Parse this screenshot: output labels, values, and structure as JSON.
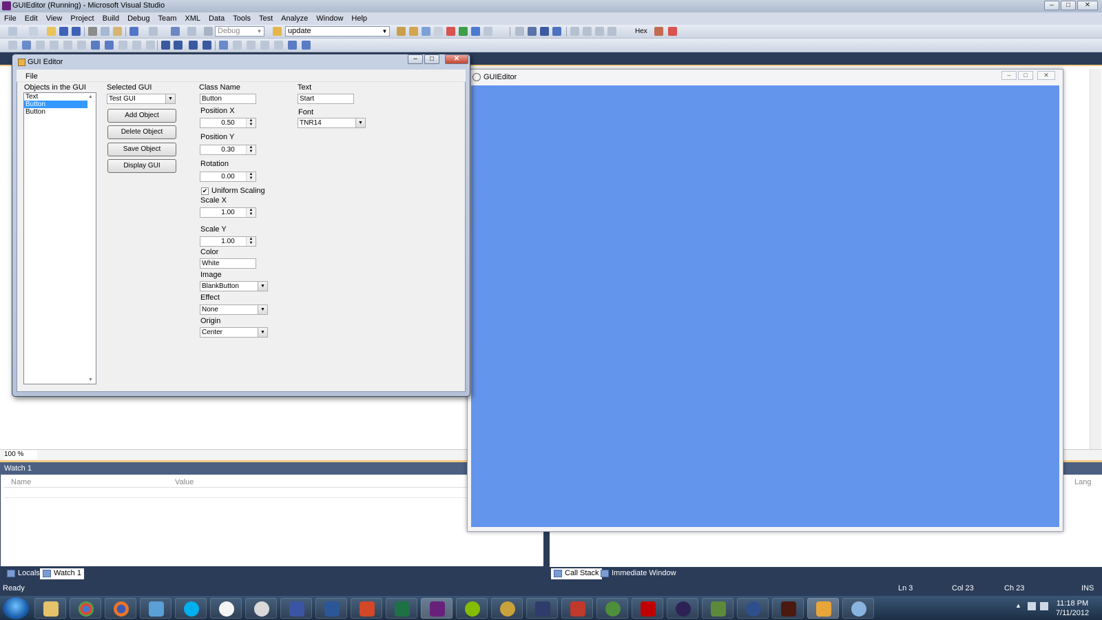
{
  "vs": {
    "title": "GUIEditor (Running) - Microsoft Visual Studio",
    "menu": [
      "File",
      "Edit",
      "View",
      "Project",
      "Build",
      "Debug",
      "Team",
      "XML",
      "Data",
      "Tools",
      "Test",
      "Analyze",
      "Window",
      "Help"
    ],
    "toolbar": {
      "config_combo": "Debug",
      "find_combo": "update",
      "hex_label": "Hex"
    },
    "zoom": "100 %",
    "watch": {
      "title": "Watch 1",
      "col_name": "Name",
      "col_value": "Value",
      "tabs": [
        "Locals",
        "Watch 1"
      ]
    },
    "callstack": {
      "lang_col": "Lang",
      "tabs": [
        "Call Stack",
        "Immediate Window"
      ]
    },
    "status": {
      "ready": "Ready",
      "ln": "Ln 3",
      "col": "Col 23",
      "ch": "Ch 23",
      "ins": "INS"
    }
  },
  "editor": {
    "title": "GUI Editor",
    "menu_file": "File",
    "objects_label": "Objects in the GUI",
    "objects": [
      "Text",
      "Button",
      "Button"
    ],
    "selected_index": 1,
    "selected_gui_label": "Selected GUI",
    "selected_gui": "Test GUI",
    "buttons": {
      "add": "Add Object",
      "delete": "Delete Object",
      "save": "Save Object",
      "display": "Display GUI"
    },
    "class_name_label": "Class Name",
    "class_name": "Button",
    "pos_x_label": "Position X",
    "pos_x": "0.50",
    "pos_y_label": "Position Y",
    "pos_y": "0.30",
    "rotation_label": "Rotation",
    "rotation": "0.00",
    "uniform_label": "Uniform Scaling",
    "uniform_checked": true,
    "scale_x_label": "Scale X",
    "scale_x": "1.00",
    "scale_y_label": "Scale Y",
    "scale_y": "1.00",
    "color_label": "Color",
    "color": "White",
    "image_label": "Image",
    "image": "BlankButton",
    "effect_label": "Effect",
    "effect": "None",
    "origin_label": "Origin",
    "origin": "Center",
    "text_label": "Text",
    "text": "Start",
    "font_label": "Font",
    "font": "TNR14"
  },
  "render": {
    "title": "GUIEditor",
    "canvas_color": "#6495ed"
  },
  "taskbar": {
    "time": "11:18 PM",
    "date": "7/11/2012",
    "apps": [
      "explorer-icon",
      "chrome-icon",
      "firefox-icon",
      "network-icon",
      "skype-icon",
      "talk-icon",
      "headset-icon",
      "vs-visio-icon",
      "word-icon",
      "powerpoint-icon",
      "excel-icon",
      "visual-studio-icon",
      "spotify-icon",
      "warcraft-icon",
      "starcraft-icon",
      "game-icon",
      "g-icon",
      "filezilla-icon",
      "eclipse-icon",
      "minecraft-icon",
      "secret-world-icon",
      "diablo-icon",
      "folder-app-icon",
      "paint-icon"
    ]
  }
}
